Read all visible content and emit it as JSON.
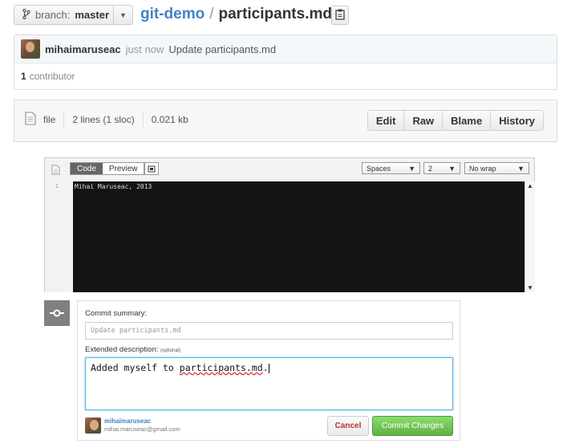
{
  "topbar": {
    "branch_label": "branch:",
    "branch_name": "master",
    "repo_name": "git-demo",
    "separator": "/",
    "file_name": "participants.md"
  },
  "commit": {
    "author": "mihaimaruseac",
    "time": "just now",
    "message": "Update participants.md",
    "contributors_count": "1",
    "contributors_label": "contributor"
  },
  "file_header": {
    "type": "file",
    "lines": "2 lines (1 sloc)",
    "size": "0.021 kb",
    "buttons": [
      "Edit",
      "Raw",
      "Blame",
      "History"
    ]
  },
  "editor": {
    "tabs": [
      "Code",
      "Preview"
    ],
    "indent_mode": "Spaces",
    "indent_size": "2",
    "wrap_mode": "No wrap",
    "line_numbers": [
      "1"
    ],
    "code_lines": [
      "Mihai Maruseac, 2013"
    ]
  },
  "commit_form": {
    "summary_label": "Commit summary:",
    "summary_placeholder": "Update participants.md",
    "description_label": "Extended description:",
    "description_optional": "(optional)",
    "description_text_before": "Added myself to ",
    "description_text_spell": "participants.md",
    "description_text_after": ".",
    "user_name": "mihaimaruseac",
    "user_email": "mihai.maruseac@gmail.com",
    "cancel_label": "Cancel",
    "commit_label": "Commit Changes"
  }
}
